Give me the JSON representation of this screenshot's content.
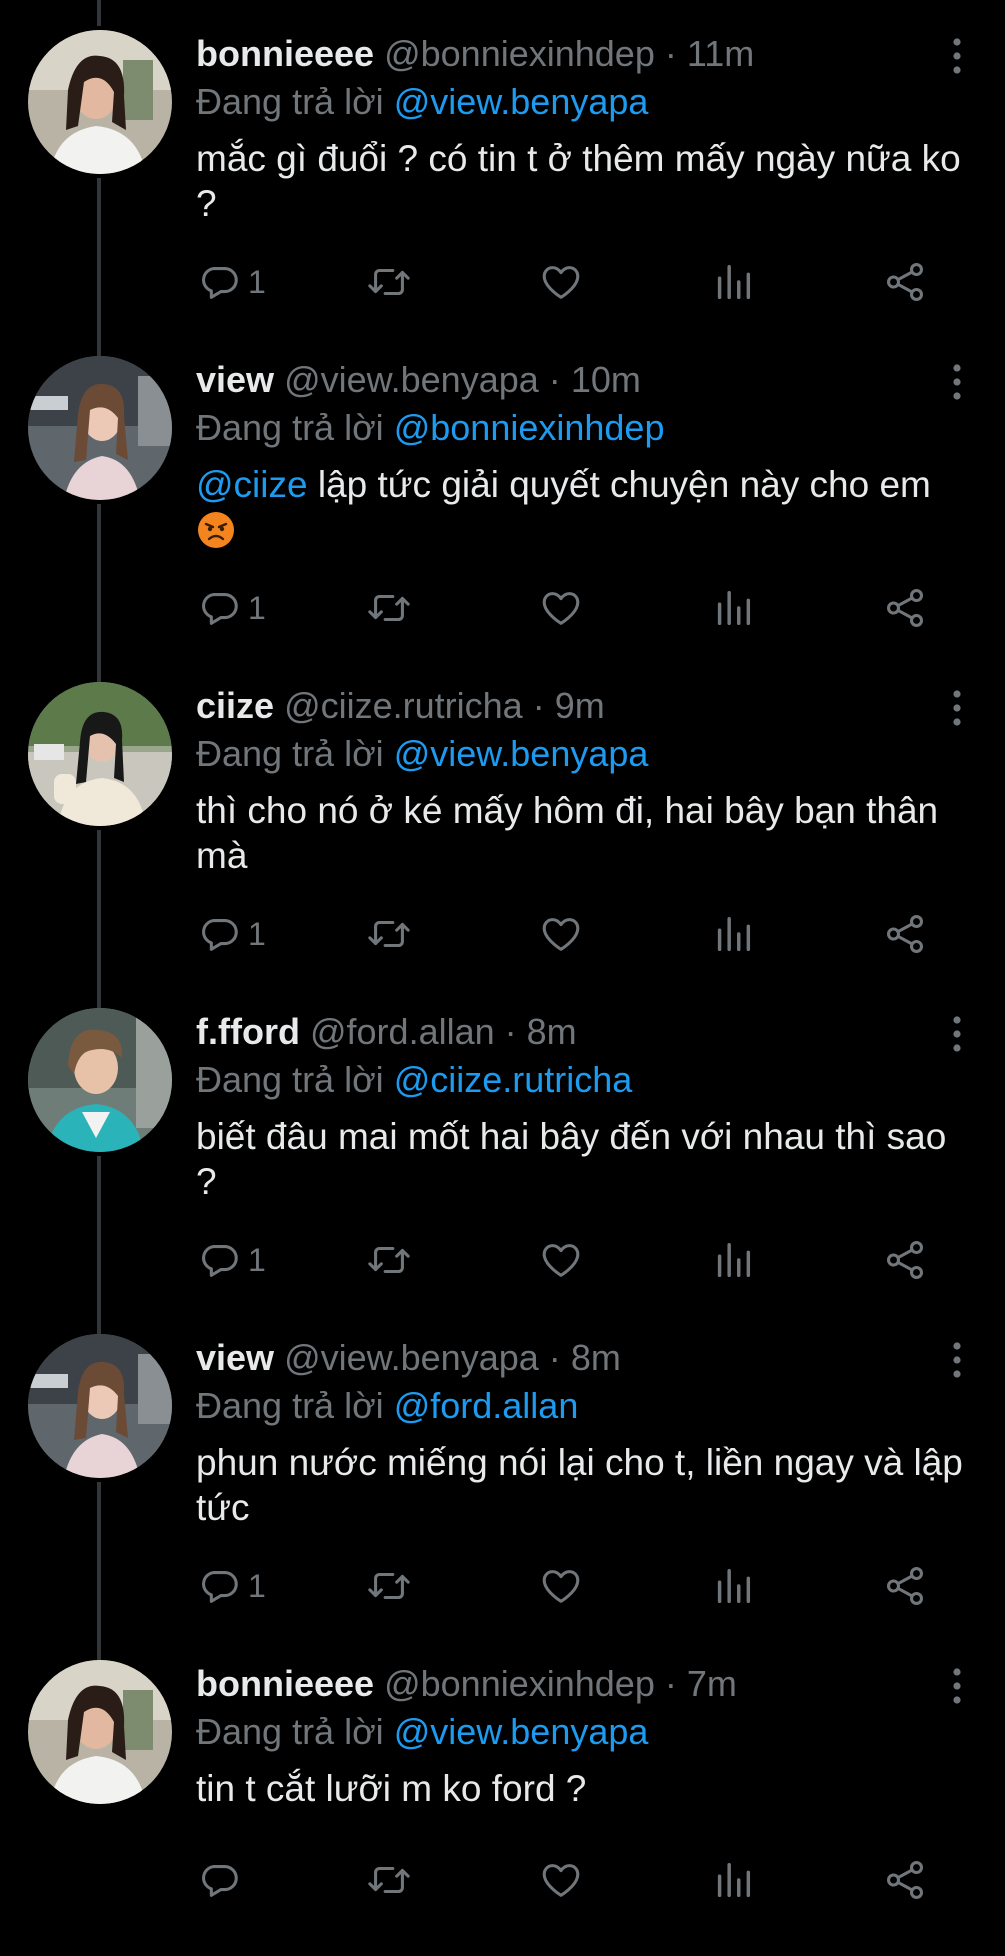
{
  "reply_prefix": "Đang trả lời",
  "colors": {
    "background": "#000000",
    "text": "#e7e9ea",
    "muted": "#71767b",
    "accent": "#1d9bf0",
    "thread_line": "#333639"
  },
  "icons": {
    "reply": "reply-icon",
    "retweet": "retweet-icon",
    "like": "heart-icon",
    "views": "views-icon",
    "share": "share-icon",
    "more": "more-options-icon",
    "angry": "angry-face-emoji"
  },
  "tweets": [
    {
      "display_name": "bonnieeee",
      "handle": "@bonniexinhdep",
      "time": "11m",
      "reply_to": "@view.benyapa",
      "text": "mắc gì đuổi ? có tin t ở thêm mấy ngày nữa ko ?",
      "reply_count": "1"
    },
    {
      "display_name": "view",
      "handle": "@view.benyapa",
      "time": "10m",
      "reply_to": "@bonniexinhdep",
      "mention": "@ciize",
      "text": " lập tức giải quyết chuyện này cho em",
      "reply_count": "1"
    },
    {
      "display_name": "ciize",
      "handle": "@ciize.rutricha",
      "time": "9m",
      "reply_to": "@view.benyapa",
      "text": "thì cho nó ở ké mấy hôm đi, hai bây bạn thân mà",
      "reply_count": "1"
    },
    {
      "display_name": "f.fford",
      "handle": "@ford.allan",
      "time": "8m",
      "reply_to": "@ciize.rutricha",
      "text": "biết đâu mai mốt hai bây đến với nhau thì sao ?",
      "reply_count": "1"
    },
    {
      "display_name": "view",
      "handle": "@view.benyapa",
      "time": "8m",
      "reply_to": "@ford.allan",
      "text": "phun nước miếng nói lại cho t, liền ngay và lập tức",
      "reply_count": "1"
    },
    {
      "display_name": "bonnieeee",
      "handle": "@bonniexinhdep",
      "time": "7m",
      "reply_to": "@view.benyapa",
      "text": "tin t cắt lưỡi m ko ford ?",
      "reply_count": ""
    }
  ]
}
